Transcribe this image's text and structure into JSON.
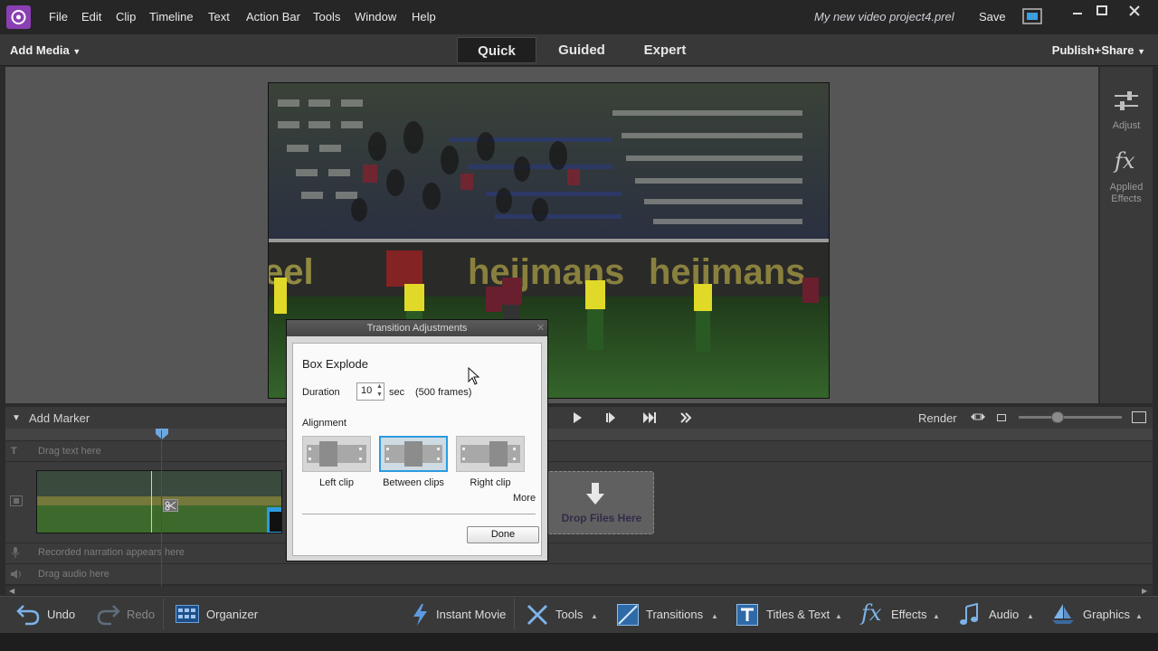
{
  "menubar": {
    "items": [
      "File",
      "Edit",
      "Clip",
      "Timeline",
      "Text",
      "Action Bar",
      "Tools",
      "Window",
      "Help"
    ],
    "project_title": "My new video project4.prel",
    "save_label": "Save"
  },
  "modebar": {
    "add_media": "Add Media",
    "tabs": [
      "Quick",
      "Guided",
      "Expert"
    ],
    "active_tab": "Quick",
    "publish": "Publish+Share"
  },
  "right_panel": {
    "adjust": "Adjust",
    "applied_effects_1": "Applied",
    "applied_effects_2": "Effects"
  },
  "timeline": {
    "add_marker": "Add Marker",
    "render": "Render",
    "text_track": "Drag text here",
    "narration_track": "Recorded narration appears here",
    "audio_track": "Drag audio here",
    "drop_files": "Drop Files Here"
  },
  "dialog": {
    "title": "Transition Adjustments",
    "transition_name": "Box Explode",
    "duration_label": "Duration",
    "duration_value": "10",
    "duration_unit": "sec",
    "frames": "(500 frames)",
    "alignment_label": "Alignment",
    "alignment_options": [
      "Left clip",
      "Between clips",
      "Right clip"
    ],
    "selected_alignment": "Between clips",
    "more": "More",
    "done": "Done"
  },
  "bottombar": {
    "undo": "Undo",
    "redo": "Redo",
    "organizer": "Organizer",
    "instant_movie": "Instant Movie",
    "tools": "Tools",
    "transitions": "Transitions",
    "titles_text": "Titles & Text",
    "effects": "Effects",
    "audio": "Audio",
    "graphics": "Graphics"
  },
  "colors": {
    "accent_purple": "#8a3fb3",
    "selection_blue": "#2b9be0",
    "playhead_red": "#dd1111"
  }
}
